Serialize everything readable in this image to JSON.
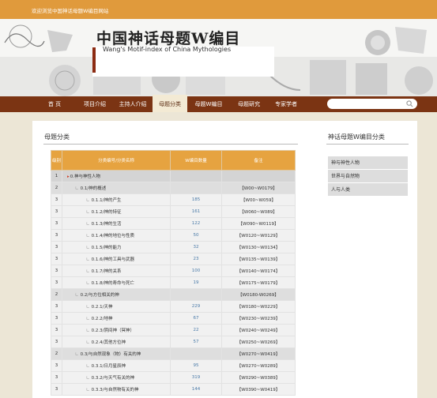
{
  "site": {
    "welcome": "欢迎浏览中国神话母题W编目网站",
    "title_cn": "中国神话母题W编目",
    "title_en": "Wang's Motif-index of China Mythologies"
  },
  "nav": {
    "items": [
      {
        "label": "首  页"
      },
      {
        "label": "项目介绍"
      },
      {
        "label": "主持人介绍"
      },
      {
        "label": "母题分类"
      },
      {
        "label": "母题W编目"
      },
      {
        "label": "母题研究"
      },
      {
        "label": "专家学者"
      }
    ],
    "active_index": 3,
    "search_placeholder": ""
  },
  "main": {
    "section_title": "母题分类",
    "table": {
      "headers": [
        "级别",
        "分类编号/分类名称",
        "W编目数量",
        "备注"
      ],
      "rows": [
        {
          "level": "1",
          "name": "0.神与神性人物",
          "count": "",
          "note": "",
          "indent": 0,
          "tier": 1
        },
        {
          "level": "2",
          "name": "0.1/神的概述",
          "count": "",
          "note": "【W00~W0179】",
          "indent": 1,
          "tier": 2
        },
        {
          "level": "3",
          "name": "0.1.1/神的产生",
          "count": "185",
          "note": "【W00~W059】",
          "indent": 2,
          "tier": 3
        },
        {
          "level": "3",
          "name": "0.1.2/神的特征",
          "count": "161",
          "note": "【W060~W089】",
          "indent": 2,
          "tier": 3
        },
        {
          "level": "3",
          "name": "0.1.3/神的生活",
          "count": "122",
          "note": "【W090~W0119】",
          "indent": 2,
          "tier": 3
        },
        {
          "level": "3",
          "name": "0.1.4/神的地位与性质",
          "count": "50",
          "note": "【W0120~W0129】",
          "indent": 2,
          "tier": 3
        },
        {
          "level": "3",
          "name": "0.1.5/神的能力",
          "count": "32",
          "note": "【W0130~W0134】",
          "indent": 2,
          "tier": 3
        },
        {
          "level": "3",
          "name": "0.1.6/神的工具与武器",
          "count": "23",
          "note": "【W0135~W0139】",
          "indent": 2,
          "tier": 3
        },
        {
          "level": "3",
          "name": "0.1.7/神的关系",
          "count": "100",
          "note": "【W0140~W0174】",
          "indent": 2,
          "tier": 3
        },
        {
          "level": "3",
          "name": "0.1.8/神的寿命与死亡",
          "count": "19",
          "note": "【W0175~W0179】",
          "indent": 2,
          "tier": 3
        },
        {
          "level": "2",
          "name": "0.2/与方位相关的神",
          "count": "",
          "note": "【W0180-W0269】",
          "indent": 1,
          "tier": 2
        },
        {
          "level": "3",
          "name": "0.2.1/天神",
          "count": "229",
          "note": "【W0180~W0229】",
          "indent": 2,
          "tier": 3
        },
        {
          "level": "3",
          "name": "0.2.2/地神",
          "count": "67",
          "note": "【W0230~W0239】",
          "indent": 2,
          "tier": 3
        },
        {
          "level": "3",
          "name": "0.2.3/阴间神（冥神）",
          "count": "22",
          "note": "【W0240~W0249】",
          "indent": 2,
          "tier": 3
        },
        {
          "level": "3",
          "name": "0.2.4/其他方位神",
          "count": "57",
          "note": "【W0250~W0269】",
          "indent": 2,
          "tier": 3
        },
        {
          "level": "2",
          "name": "0.3/与自然现象（物）有关的神",
          "count": "",
          "note": "【W0270~W0419】",
          "indent": 1,
          "tier": 2
        },
        {
          "level": "3",
          "name": "0.3.1/日月星辰神",
          "count": "95",
          "note": "【W0270~W0289】",
          "indent": 2,
          "tier": 3
        },
        {
          "level": "3",
          "name": "0.3.2/与天气有关的神",
          "count": "319",
          "note": "【W0290~W0389】",
          "indent": 2,
          "tier": 3
        },
        {
          "level": "3",
          "name": "0.3.3/与自然物有关的神",
          "count": "144",
          "note": "【W0390~W0419】",
          "indent": 2,
          "tier": 3
        }
      ]
    }
  },
  "sidebar": {
    "title": "神话母题W编目分类",
    "items": [
      {
        "label": "神与神性人物"
      },
      {
        "label": "世界与自然物"
      },
      {
        "label": "人与人类"
      }
    ]
  },
  "colors": {
    "topbar": "#e09a3c",
    "nav": "#7b3413",
    "table_header": "#e6a340",
    "link_number": "#4a7aa8"
  }
}
